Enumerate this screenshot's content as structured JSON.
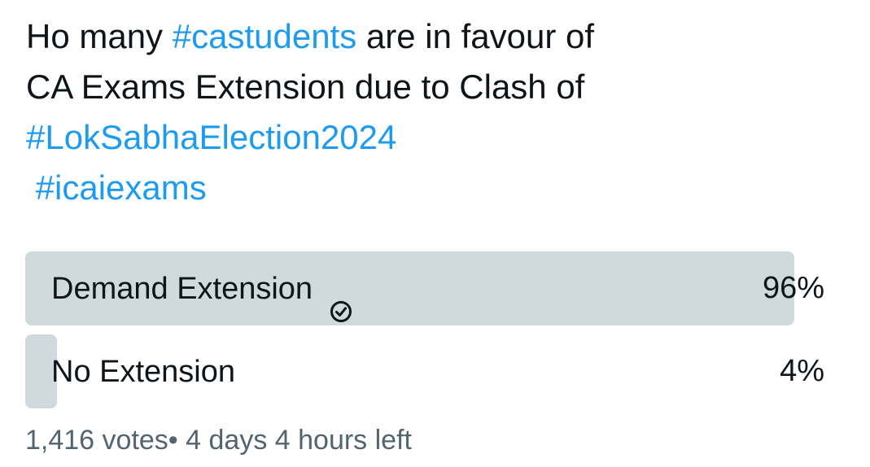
{
  "tweet": {
    "line1_pre": "Ho many ",
    "line1_hashtag": "#castudents",
    "line1_post": " are in favour of",
    "line2": "CA Exams Extension due to Clash of",
    "line3_hashtag": "#LokSabhaElection2024",
    "line4_hashtag": " #icaiexams"
  },
  "poll": {
    "options": [
      {
        "label": "Demand Extension",
        "percent_text": "96%",
        "percent": 96,
        "selected": true
      },
      {
        "label": "No Extension",
        "percent_text": "4%",
        "percent": 4,
        "selected": false
      }
    ],
    "votes": "1,416 votes",
    "separator": "•",
    "time_left": " 4 days 4 hours left"
  },
  "colors": {
    "text": "#0f1419",
    "hashtag": "#1d9bf0",
    "poll_fill": "#cfd9de",
    "muted": "#536471"
  },
  "icons": {
    "selected_option": "check-circle-icon"
  }
}
